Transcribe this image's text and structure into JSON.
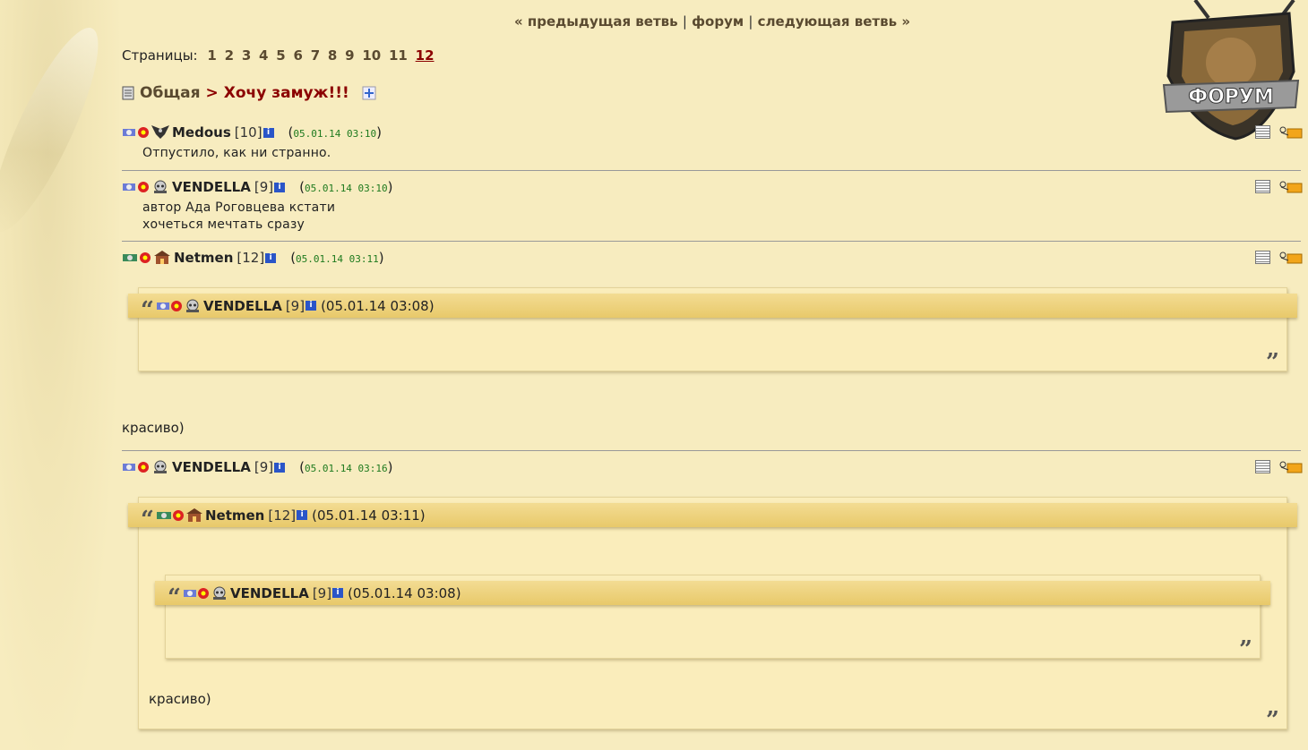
{
  "nav": {
    "prev": "« предыдущая ветвь",
    "forum": "форум",
    "next": "следующая ветвь »",
    "sep": "|"
  },
  "logo_text": "ФОРУМ",
  "pages": {
    "label": "Страницы:",
    "items": [
      "1",
      "2",
      "3",
      "4",
      "5",
      "6",
      "7",
      "8",
      "9",
      "10",
      "11",
      "12"
    ],
    "current": "12"
  },
  "breadcrumb": {
    "section": "Общая",
    "arrow": ">",
    "topic": "Хочу замуж!!!"
  },
  "posts": [
    {
      "nick": "Medous",
      "level": "[10]",
      "time": "05.01.14 03:10",
      "lines": [
        "Отпустило, как ни странно."
      ]
    },
    {
      "nick": "VENDELLA",
      "level": "[9]",
      "time": "05.01.14 03:10",
      "lines": [
        "автор Ада Роговцева кстати",
        "хочеться мечтать сразу"
      ]
    },
    {
      "nick": "Netmen",
      "level": "[12]",
      "time": "05.01.14 03:11",
      "quote": {
        "nick": "VENDELLA",
        "level": "[9]",
        "time": "(05.01.14 03:08)"
      },
      "text": "красиво)"
    },
    {
      "nick": "VENDELLA",
      "level": "[9]",
      "time": "05.01.14 03:16",
      "quote": {
        "nick": "Netmen",
        "level": "[12]",
        "time": "(05.01.14 03:11)",
        "inner": {
          "nick": "VENDELLA",
          "level": "[9]",
          "time": "(05.01.14 03:08)"
        },
        "text": "красиво)"
      }
    }
  ],
  "info_glyph": "i"
}
